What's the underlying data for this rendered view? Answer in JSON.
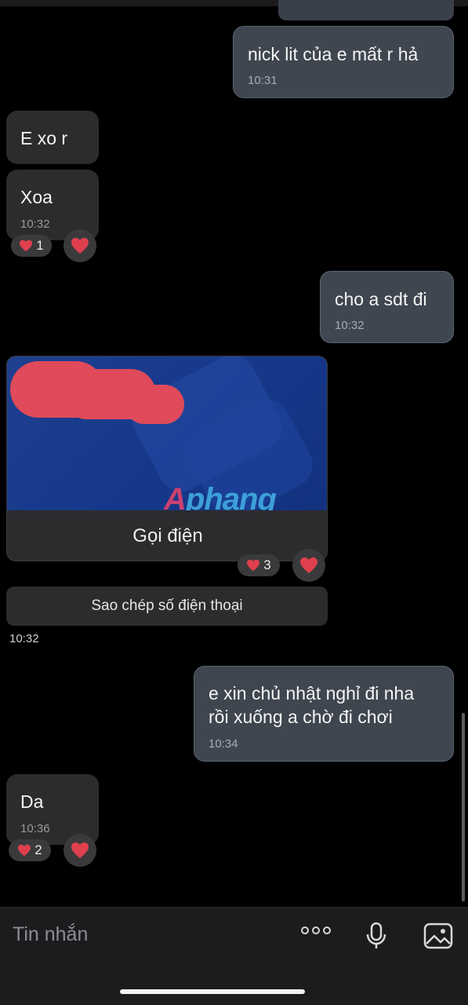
{
  "messages": [
    {
      "text": "nick lit của e mất r hả",
      "time": "10:31"
    },
    {
      "text": "E xo r"
    },
    {
      "text": "Xoa",
      "time": "10:32",
      "reaction_count": "1"
    },
    {
      "text": "cho a sdt đi",
      "time": "10:32"
    },
    {
      "text": "e xin chủ nhật nghỉ đi nha\nrồi xuống a chờ đi chơi",
      "time": "10:34"
    },
    {
      "text": "Da",
      "time": "10:36",
      "reaction_count": "2"
    }
  ],
  "call_card": {
    "watermark_first": "A",
    "watermark_rest": "phang",
    "label": "Gọi điện",
    "reaction_count": "3",
    "copy_label": "Sao chép số điện thoại",
    "time": "10:32"
  },
  "composer": {
    "placeholder": "Tin nhắn"
  },
  "colors": {
    "outgoing_bubble": "#3f4650",
    "incoming_bubble": "#2c2c2e",
    "heart": "#e0404e",
    "banner": "#1f3f8f"
  },
  "icons": [
    "heart-icon",
    "more-icon",
    "microphone-icon",
    "gallery-icon"
  ]
}
